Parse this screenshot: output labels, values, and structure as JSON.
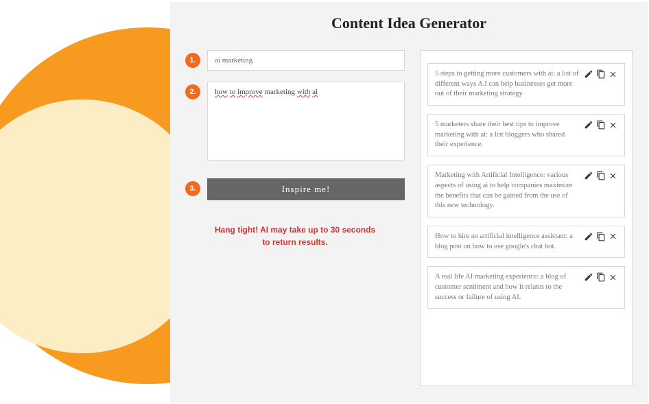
{
  "page_title": "Content Idea Generator",
  "steps": {
    "s1": {
      "num": "1.",
      "topic_value": "ai marketing"
    },
    "s2": {
      "num": "2.",
      "details_plain": "how to improve marketing with ai"
    },
    "s3": {
      "num": "3.",
      "button_label": "Inspire me!"
    }
  },
  "status_line1": "Hang tight! AI may take up to 30 seconds",
  "status_line2": "to return results.",
  "results": {
    "r1": "5 steps to getting more customers with ai: a list of different ways A.I can help businesses get more out of their marketing strategy",
    "r2": "5 marketers share their best tips to improve marketing with ai: a list bloggers who shared their experience.",
    "r3": "Marketing with Artificial Intelligence: various aspects of using ai to help companies maximize the benefits that can be gained from the use of this new technology.",
    "r4": "How to hire an artificial intelligence assistant: a blog post on how to use google's chat bot.",
    "r5": "A real life AI marketing experience: a blog of customer sentiment and how it relates to the success or failure of using AI."
  }
}
